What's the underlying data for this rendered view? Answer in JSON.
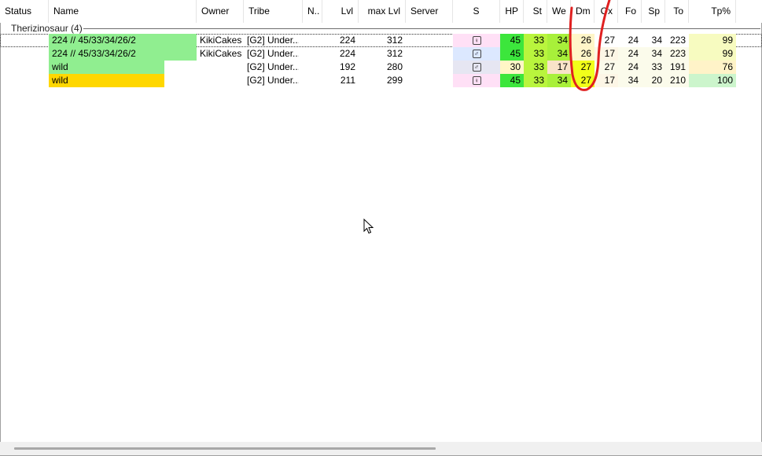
{
  "columns": [
    {
      "key": "status",
      "label": "Status"
    },
    {
      "key": "name",
      "label": "Name"
    },
    {
      "key": "owner",
      "label": "Owner"
    },
    {
      "key": "tribe",
      "label": "Tribe"
    },
    {
      "key": "note",
      "label": "N.."
    },
    {
      "key": "lvl",
      "label": "Lvl"
    },
    {
      "key": "maxlvl",
      "label": "max Lvl"
    },
    {
      "key": "server",
      "label": "Server"
    },
    {
      "key": "sex",
      "label": "S"
    },
    {
      "key": "hp",
      "label": "HP"
    },
    {
      "key": "st",
      "label": "St"
    },
    {
      "key": "we",
      "label": "We"
    },
    {
      "key": "dm",
      "label": "Dm"
    },
    {
      "key": "ox",
      "label": "Ox"
    },
    {
      "key": "fo",
      "label": "Fo"
    },
    {
      "key": "sp",
      "label": "Sp"
    },
    {
      "key": "to",
      "label": "To"
    },
    {
      "key": "tp",
      "label": "Tp%"
    }
  ],
  "group": {
    "label": "Therizinosaur (4)"
  },
  "rows": [
    {
      "name": "224 // 45/33/34/26/2",
      "owner": "KikiCakes",
      "tribe": "[G2] Under...",
      "lvl": "224",
      "maxlvl": "312",
      "sex": "♀",
      "hp": "45",
      "st": "33",
      "we": "34",
      "dm": "26",
      "ox": "27",
      "fo": "24",
      "sp": "34",
      "to": "223",
      "tp": "99",
      "colors": {
        "name": "#90ee90",
        "sex": "#ffe0f6",
        "hp": "#3ce63c",
        "st": "#b9f53d",
        "we": "#a8f03a",
        "dm": "#fff6c8",
        "ox": "#ffffff",
        "fo": "#ffffff",
        "sp": "#ffffff",
        "to": "#ffffff",
        "tp": "#f7fbc0"
      }
    },
    {
      "name": "224 // 45/33/34/26/2",
      "owner": "KikiCakes",
      "tribe": "[G2] Under...",
      "lvl": "224",
      "maxlvl": "312",
      "sex": "♂",
      "hp": "45",
      "st": "33",
      "we": "34",
      "dm": "26",
      "ox": "17",
      "fo": "24",
      "sp": "34",
      "to": "223",
      "tp": "99",
      "colors": {
        "name": "#90ee90",
        "sex": "#dce8ff",
        "hp": "#3ce63c",
        "st": "#b9f53d",
        "we": "#a8f03a",
        "dm": "#fff6c8",
        "ox": "#fdf6e6",
        "fo": "#fbfbeb",
        "sp": "#fbfbeb",
        "to": "#fbfbeb",
        "tp": "#f7fbc0"
      }
    },
    {
      "name": "wild",
      "owner": "",
      "tribe": "[G2] Under...",
      "lvl": "192",
      "maxlvl": "280",
      "sex": "♂",
      "hp": "30",
      "st": "33",
      "we": "17",
      "dm": "27",
      "ox": "27",
      "fo": "24",
      "sp": "33",
      "to": "191",
      "tp": "76",
      "colors": {
        "name": "#90ee90",
        "sex": "#e6e6f2",
        "hp": "#fff6c6",
        "st": "#b9f53d",
        "we": "#f9e3c8",
        "dm": "#f2ff1a",
        "ox": "#fbfbeb",
        "fo": "#fbfbeb",
        "sp": "#fbfbeb",
        "to": "#fbfbeb",
        "tp": "#fff3c8"
      }
    },
    {
      "name": "wild",
      "owner": "",
      "tribe": "[G2] Under...",
      "lvl": "211",
      "maxlvl": "299",
      "sex": "♀",
      "hp": "45",
      "st": "33",
      "we": "34",
      "dm": "27",
      "ox": "17",
      "fo": "34",
      "sp": "20",
      "to": "210",
      "tp": "100",
      "colors": {
        "name": "#ffd700",
        "sex": "#ffe0f6",
        "hp": "#3ce63c",
        "st": "#b9f53d",
        "we": "#a8f03a",
        "dm": "#f2ff1a",
        "ox": "#fdf6e6",
        "fo": "#fbfbeb",
        "sp": "#fbfbeb",
        "to": "#fbfbeb",
        "tp": "#ccf5cc"
      }
    }
  ],
  "annotation_color": "#e02020"
}
